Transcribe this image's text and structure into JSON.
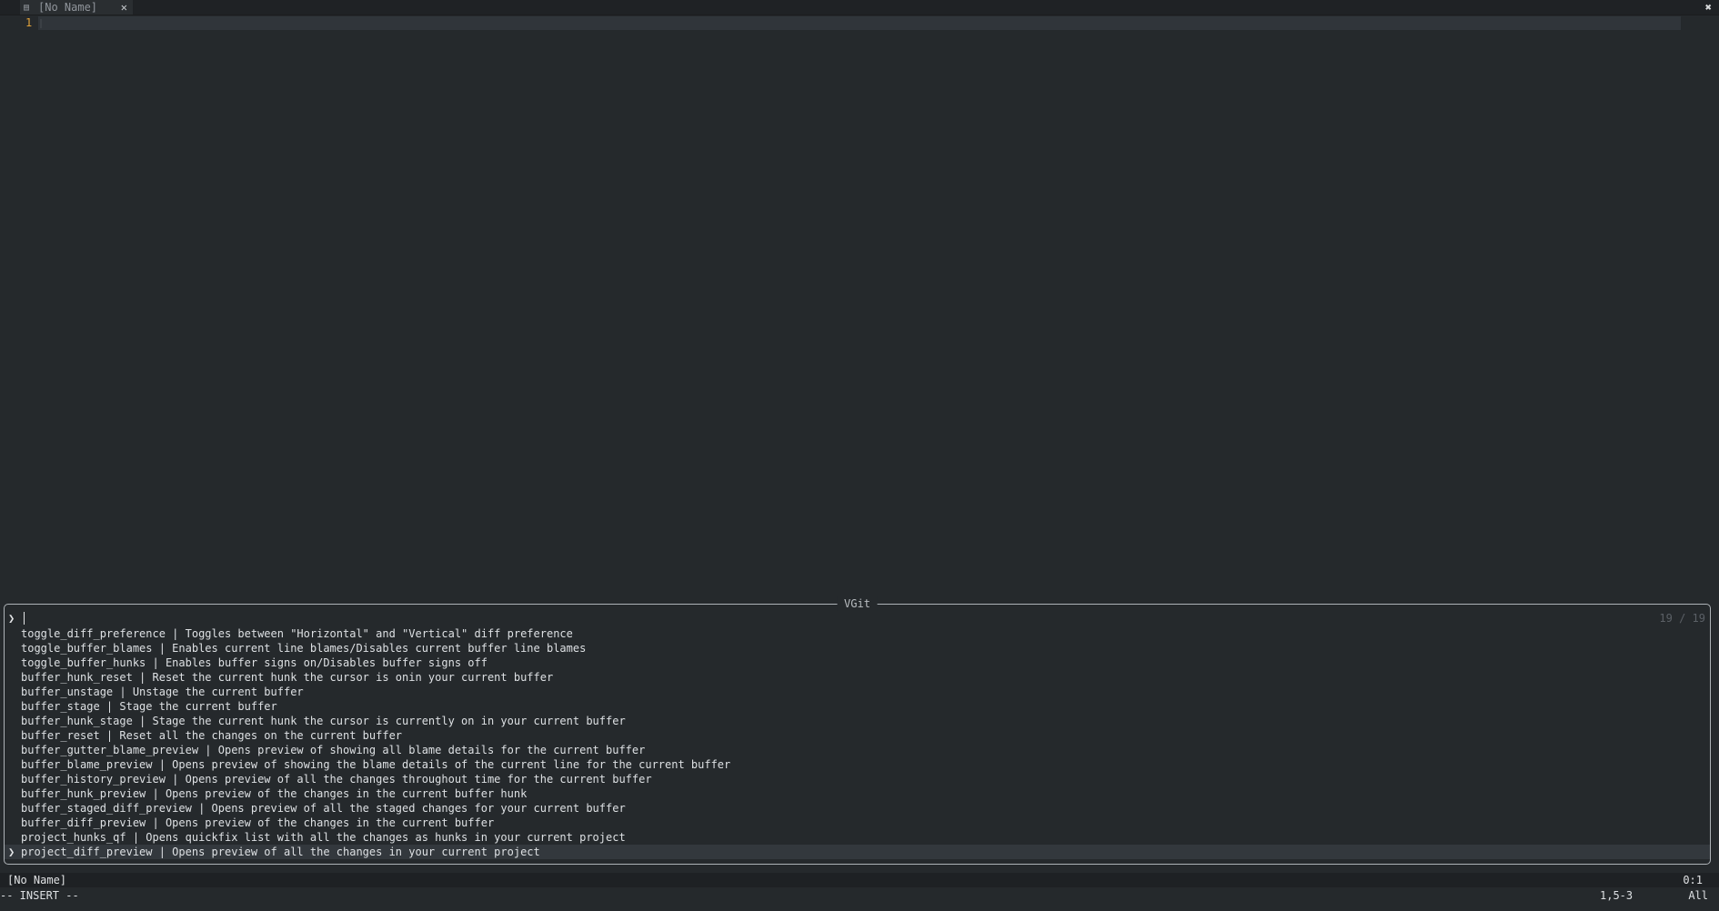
{
  "tabline": {
    "tab_title": "[No Name]",
    "tab_close_glyph": "✕",
    "window_close_glyph": "✖",
    "file_icon": "file-icon"
  },
  "editor": {
    "line_number": "1"
  },
  "picker": {
    "title": "VGit",
    "prompt_symbol": "❯",
    "prompt_value": "",
    "counter": "19 / 19",
    "selection_marker": "❯",
    "results": [
      "toggle_diff_preference | Toggles between \"Horizontal\" and \"Vertical\" diff preference",
      "toggle_buffer_blames | Enables current line blames/Disables current buffer line blames",
      "toggle_buffer_hunks | Enables buffer signs on/Disables buffer signs off",
      "buffer_hunk_reset | Reset the current hunk the cursor is onin your current buffer",
      "buffer_unstage | Unstage the current buffer",
      "buffer_stage | Stage the current buffer",
      "buffer_hunk_stage | Stage the current hunk the cursor is currently on in your current buffer",
      "buffer_reset | Reset all the changes on the current buffer",
      "buffer_gutter_blame_preview | Opens preview of showing all blame details for the current buffer",
      "buffer_blame_preview | Opens preview of showing the blame details of the current line for the current buffer",
      "buffer_history_preview | Opens preview of all the changes throughout time for the current buffer",
      "buffer_hunk_preview | Opens preview of the changes in the current buffer hunk",
      "buffer_staged_diff_preview | Opens preview of all the staged changes for your current buffer",
      "buffer_diff_preview | Opens preview of the changes in the current buffer",
      "project_hunks_qf | Opens quickfix list with all the changes as hunks in your current project",
      "project_diff_preview | Opens preview of all the changes in your current project"
    ]
  },
  "statusline": {
    "file": "[No Name]",
    "position": "0:1"
  },
  "cmdline": {
    "mode": "-- INSERT --",
    "ruler": "1,5-3",
    "scroll": "All"
  },
  "colors": {
    "background": "#25292c",
    "line_number": "#e0a23a",
    "border": "#aeb3b7",
    "selected_row": "#33383d"
  }
}
